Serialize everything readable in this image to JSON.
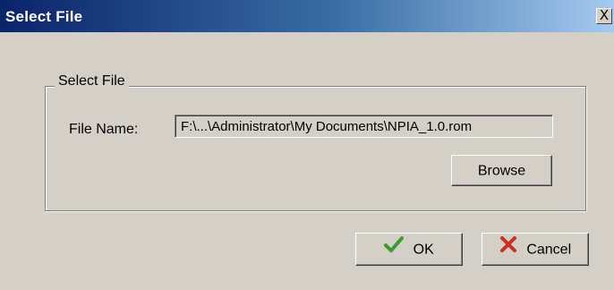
{
  "window": {
    "title": "Select File",
    "close_glyph": "X"
  },
  "group": {
    "legend": "Select File"
  },
  "file_name": {
    "label": "File Name:",
    "value": "F:\\...\\Administrator\\My Documents\\NPIA_1.0.rom"
  },
  "buttons": {
    "browse": "Browse",
    "ok": "OK",
    "cancel": "Cancel"
  },
  "icons": {
    "ok": "checkmark-icon",
    "cancel": "x-mark-icon"
  },
  "colors": {
    "check_green": "#3c9a2e",
    "cancel_red": "#c8321e"
  }
}
